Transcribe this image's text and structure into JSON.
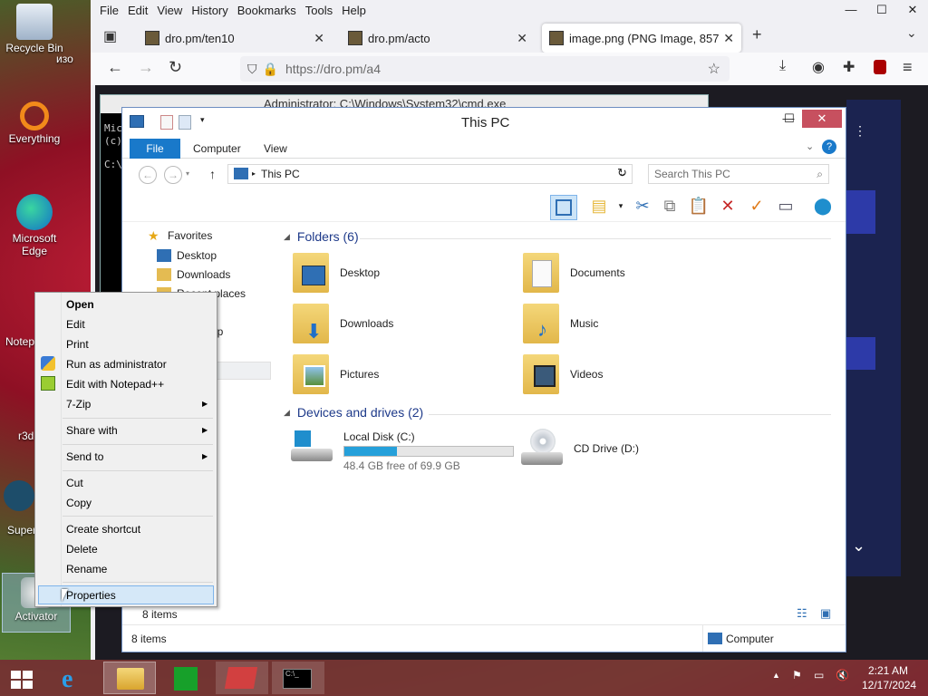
{
  "desktop": {
    "icons": [
      {
        "label": "Recycle Bin"
      },
      {
        "label": "изо"
      },
      {
        "label": "Everything"
      },
      {
        "label": "Microsoft Edge"
      },
      {
        "label": "Notep"
      },
      {
        "label": "r3d"
      },
      {
        "label": "Super"
      },
      {
        "label": "Activator"
      }
    ]
  },
  "firefox": {
    "menu": [
      "File",
      "Edit",
      "View",
      "History",
      "Bookmarks",
      "Tools",
      "Help"
    ],
    "tabs": [
      {
        "title": "dro.pm/ten10"
      },
      {
        "title": "dro.pm/acto"
      },
      {
        "title": "image.png (PNG Image, 857 ×"
      }
    ],
    "new_tab": "+",
    "url": "https://dro.pm/a4"
  },
  "cmd": {
    "title": "Administrator: C:\\Windows\\System32\\cmd.exe",
    "lines": [
      "Mic",
      "(c)",
      "C:\\"
    ]
  },
  "explorer": {
    "title": "This PC",
    "ribbon_tabs": [
      "File",
      "Computer",
      "View"
    ],
    "breadcrumb": "This PC",
    "search_placeholder": "Search This PC",
    "nav": {
      "favorites": "Favorites",
      "desktop": "Desktop",
      "downloads": "Downloads",
      "recent_places": "Recent places",
      "obscured_item": "up"
    },
    "folders_header": "Folders (6)",
    "folders": [
      {
        "name": "Desktop"
      },
      {
        "name": "Documents"
      },
      {
        "name": "Downloads"
      },
      {
        "name": "Music"
      },
      {
        "name": "Pictures"
      },
      {
        "name": "Videos"
      }
    ],
    "devices_header": "Devices and drives (2)",
    "drives": [
      {
        "name": "Local Disk (C:)",
        "free": "48.4 GB free of 69.9 GB",
        "used_fraction": 0.31
      },
      {
        "name": "CD Drive (D:)"
      }
    ],
    "inner_status": "8 items",
    "status_items": "8 items",
    "status_location": "Computer"
  },
  "context_menu": {
    "items": [
      {
        "label": "Open",
        "bold": true
      },
      {
        "label": "Edit"
      },
      {
        "label": "Print"
      },
      {
        "label": "Run as administrator"
      },
      {
        "label": "Edit with Notepad++"
      },
      {
        "label": "7-Zip",
        "submenu": true
      },
      {
        "label": "Share with",
        "submenu": true
      },
      {
        "label": "Send to",
        "submenu": true
      },
      {
        "label": "Cut"
      },
      {
        "label": "Copy"
      },
      {
        "label": "Create shortcut"
      },
      {
        "label": "Delete"
      },
      {
        "label": "Rename"
      },
      {
        "label": "Properties",
        "highlighted": true
      }
    ]
  },
  "taskbar": {
    "time": "2:21 AM",
    "date": "12/17/2024"
  },
  "colors": {
    "accent_blue": "#1979ca",
    "drive_bar": "#26a0da",
    "taskbar": "#782832"
  }
}
